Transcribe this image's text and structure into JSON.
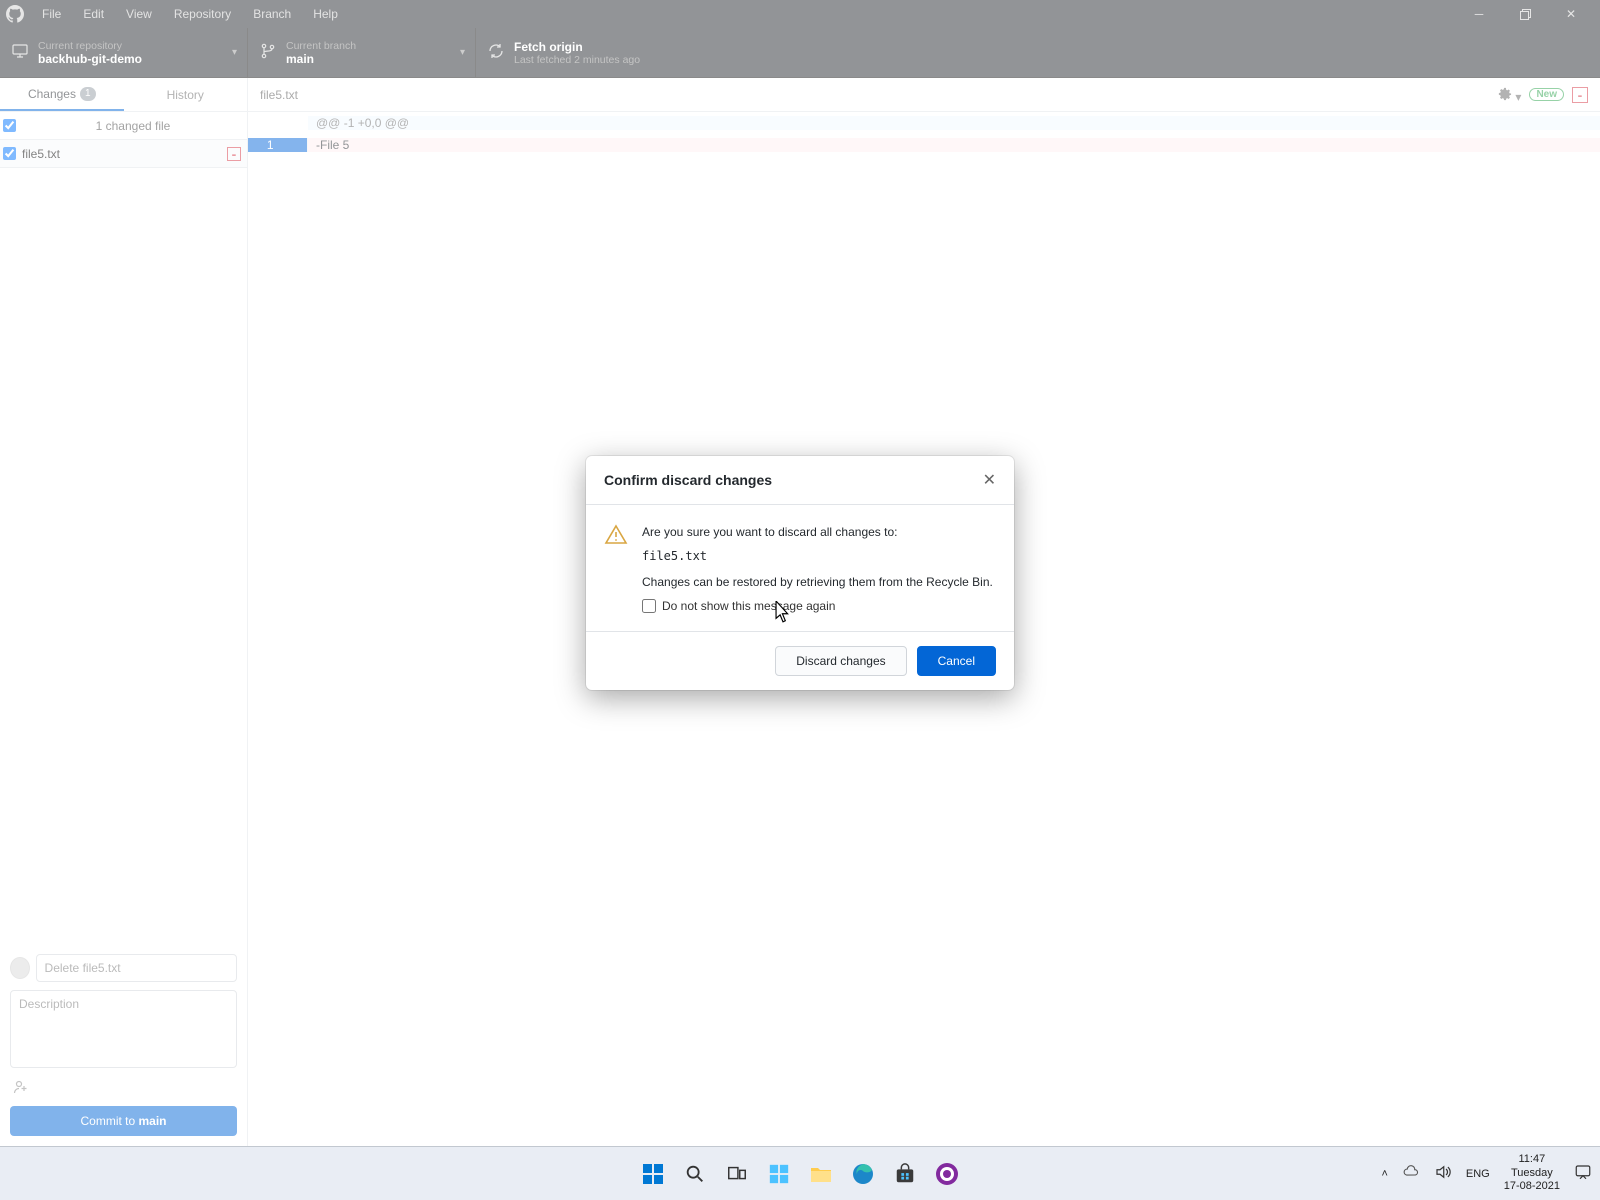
{
  "menu": {
    "file": "File",
    "edit": "Edit",
    "view": "View",
    "repository": "Repository",
    "branch": "Branch",
    "help": "Help"
  },
  "toolbar": {
    "repo_label": "Current repository",
    "repo_name": "backhub-git-demo",
    "branch_label": "Current branch",
    "branch_name": "main",
    "fetch_title": "Fetch origin",
    "fetch_sub": "Last fetched 2 minutes ago"
  },
  "tabs": {
    "changes": "Changes",
    "changes_count": "1",
    "history": "History"
  },
  "changed_files_header": "1 changed file",
  "files": [
    {
      "name": "file5.txt"
    }
  ],
  "commit": {
    "summary_placeholder": "Delete file5.txt",
    "description_placeholder": "Description",
    "button_pre": "Commit to ",
    "button_branch": "main"
  },
  "diff": {
    "filename": "file5.txt",
    "new_badge": "New",
    "hunk": "@@ -1 +0,0 @@",
    "line_old": "1",
    "del_text": "-File 5"
  },
  "dialog": {
    "title": "Confirm discard changes",
    "msg1": "Are you sure you want to discard all changes to:",
    "filename": "file5.txt",
    "msg2": "Changes can be restored by retrieving them from the Recycle Bin.",
    "checkbox_label": "Do not show this message again",
    "discard": "Discard changes",
    "cancel": "Cancel"
  },
  "tray": {
    "lang": "ENG",
    "time": "11:47",
    "day": "Tuesday",
    "date": "17-08-2021"
  }
}
